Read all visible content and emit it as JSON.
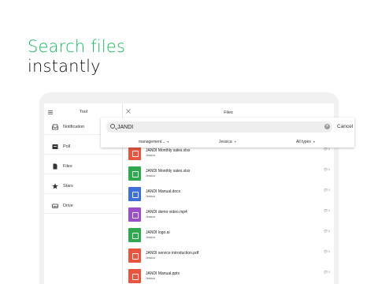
{
  "headline": {
    "line1": "Search files",
    "line2": "instantly"
  },
  "sidebar": {
    "title": "Tool",
    "items": [
      {
        "label": "Notification",
        "icon": "inbox-icon"
      },
      {
        "label": "Poll",
        "icon": "poll-icon"
      },
      {
        "label": "Files",
        "icon": "file-icon"
      },
      {
        "label": "Stars",
        "icon": "star-icon"
      },
      {
        "label": "Drive",
        "icon": "drive-icon"
      }
    ]
  },
  "main": {
    "title": "Files"
  },
  "search": {
    "value": "JANDI",
    "cancel_label": "Cancel",
    "filters": [
      {
        "label": "management..."
      },
      {
        "label": "Jessica"
      },
      {
        "label": "All types"
      }
    ]
  },
  "files": [
    {
      "name": "JANDI Monthly sales.xlsx",
      "owner": "Jessica",
      "color": "#e7553f",
      "count": "0"
    },
    {
      "name": "JANDI Monthly sales.xlsx",
      "owner": "Jessica",
      "color": "#2fa84f",
      "count": "0"
    },
    {
      "name": "JANDI Manual.docx",
      "owner": "Jessica",
      "color": "#3f6fd8",
      "count": "0"
    },
    {
      "name": "JANDI demo video.mp4",
      "owner": "Jessica",
      "color": "#9b4dca",
      "count": "0"
    },
    {
      "name": "JANDI logo.ai",
      "owner": "Jessica",
      "color": "#2fa84f",
      "count": "0"
    },
    {
      "name": "JANDI service introduction.pdf",
      "owner": "Jessica",
      "color": "#e7553f",
      "count": "0"
    },
    {
      "name": "JANDI Manual.pptx",
      "owner": "Jessica",
      "color": "#e7553f",
      "count": "0"
    }
  ],
  "colors": {
    "accent": "#19b45a"
  }
}
